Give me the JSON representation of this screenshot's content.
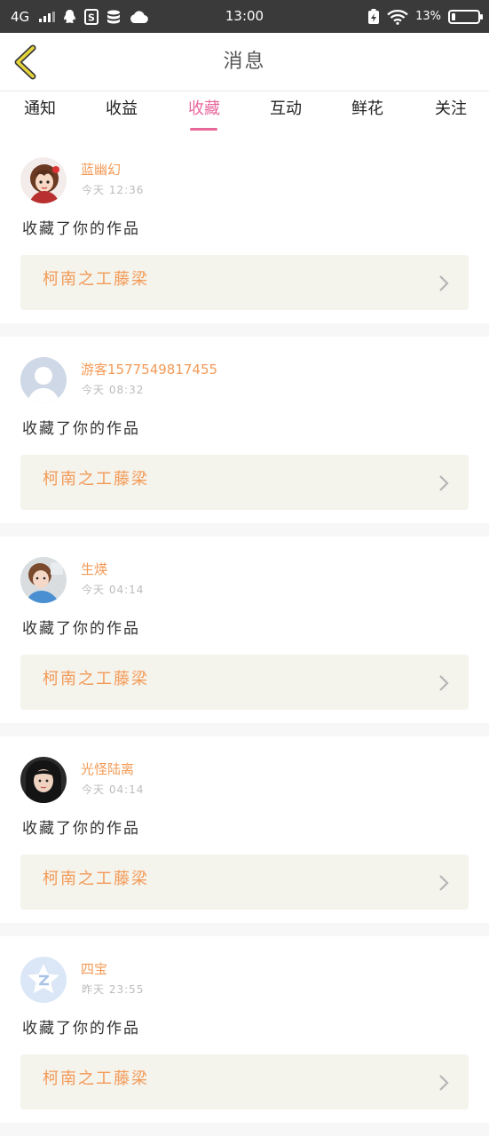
{
  "status_bar": {
    "network": "4G",
    "time": "13:00",
    "battery": "13%",
    "battery_level": 0.13
  },
  "header": {
    "title": "消息",
    "back_icon": "chevron-left-icon"
  },
  "tabs": [
    {
      "label": "通知",
      "active": false
    },
    {
      "label": "收益",
      "active": false
    },
    {
      "label": "收藏",
      "active": true
    },
    {
      "label": "互动",
      "active": false
    },
    {
      "label": "鲜花",
      "active": false
    },
    {
      "label": "关注",
      "active": false
    }
  ],
  "colors": {
    "accent_pink": "#e8679b",
    "name_orange": "#f39a56",
    "link_bg": "#f4f3ec"
  },
  "messages": [
    {
      "user": "蓝幽幻",
      "time": "今天  12:36",
      "action": "收藏了你的作品",
      "work": "柯南之工藤梁",
      "avatar": "anime-girl-avatar"
    },
    {
      "user": "游客1577549817455",
      "time": "今天  08:32",
      "action": "收藏了你的作品",
      "work": "柯南之工藤梁",
      "avatar": "default-user-avatar"
    },
    {
      "user": "生煐",
      "time": "今天  04:14",
      "action": "收藏了你的作品",
      "work": "柯南之工藤梁",
      "avatar": "girl-photo-avatar"
    },
    {
      "user": "光怪陆离",
      "time": "今天  04:14",
      "action": "收藏了你的作品",
      "work": "柯南之工藤梁",
      "avatar": "dark-hair-photo-avatar"
    },
    {
      "user": "四宝",
      "time": "昨天  23:55",
      "action": "收藏了你的作品",
      "work": "柯南之工藤梁",
      "avatar": "qq-star-avatar"
    }
  ]
}
